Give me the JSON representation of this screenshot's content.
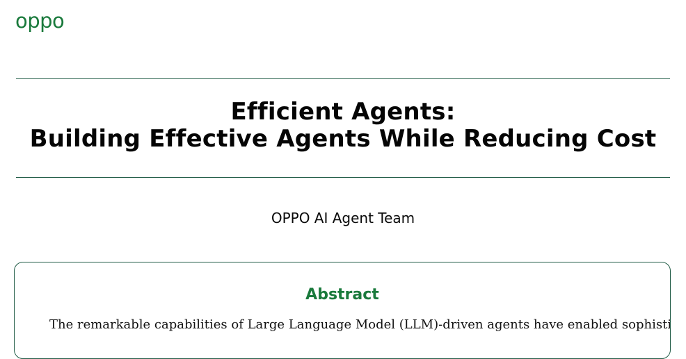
{
  "header": {
    "logo_text": "oppo"
  },
  "colors": {
    "brand_green": "#1a7a3c",
    "rule_green": "#1f5b45"
  },
  "paper": {
    "title_line1": "Efficient Agents:",
    "title_line2": "Building Effective Agents While Reducing Cost",
    "authors": "OPPO AI Agent Team"
  },
  "abstract": {
    "heading": "Abstract",
    "text_visible": "The remarkable capabilities of Large Language Model (LLM)-driven agents have enabled sophisti"
  }
}
